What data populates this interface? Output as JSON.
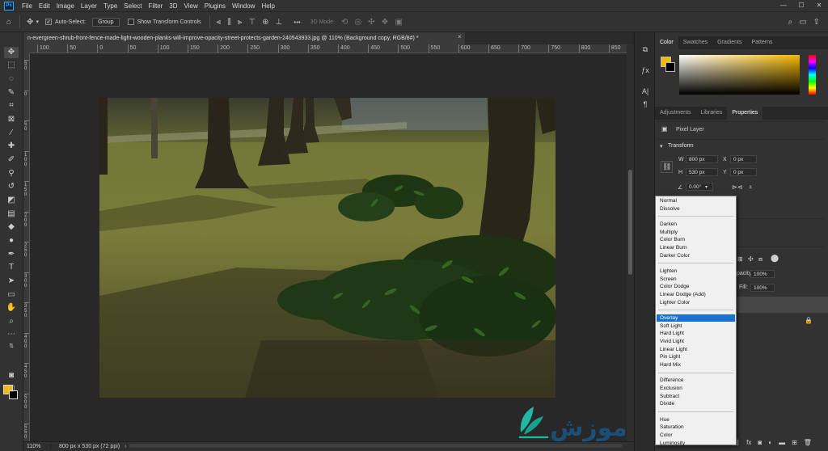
{
  "app": {
    "logo": "Ps"
  },
  "menu": [
    "File",
    "Edit",
    "Image",
    "Layer",
    "Type",
    "Select",
    "Filter",
    "3D",
    "View",
    "Plugins",
    "Window",
    "Help"
  ],
  "window_controls": {
    "minimize": "—",
    "maximize": "☐",
    "close": "✕"
  },
  "options_bar": {
    "auto_select_label": "Auto-Select:",
    "auto_select_checked": true,
    "group_value": "Group",
    "transform_label": "Show Transform Controls",
    "transform_checked": false,
    "more": "•••",
    "mode_3d_label": "3D Mode:"
  },
  "document": {
    "tab_title": "n-evergreen-shrub-front-fence-made-light-wooden-planks-will-improve-opacity-street-protects-garden-240543933.jpg @ 110% (Background copy, RGB/8#) *",
    "close": "×",
    "zoom": "110%",
    "info": "800 px x 530 px (72 ppi)",
    "info_arrow": "›"
  },
  "ruler": {
    "h_labels": [
      "100",
      "50",
      "0",
      "50",
      "100",
      "150",
      "200",
      "250",
      "300",
      "350",
      "400",
      "450",
      "500",
      "550",
      "600",
      "650",
      "700",
      "750",
      "800",
      "850",
      "900"
    ],
    "v_labels": [
      "50",
      "0",
      "50",
      "100",
      "150",
      "200",
      "250",
      "300",
      "350",
      "400",
      "450",
      "500",
      "550"
    ]
  },
  "colors": {
    "foreground": "#f5b800",
    "background": "#000000",
    "accent": "#1870d0"
  },
  "color_panel": {
    "tabs": [
      "Color",
      "Swatches",
      "Gradients",
      "Patterns"
    ],
    "active": "Color"
  },
  "properties_panel": {
    "tabs": [
      "Adjustments",
      "Libraries",
      "Properties"
    ],
    "active": "Properties",
    "layer_type": "Pixel Layer",
    "section": "Transform",
    "w_label": "W",
    "w_value": "800 px",
    "h_label": "H",
    "h_value": "530 px",
    "x_label": "X",
    "x_value": "0 px",
    "y_label": "Y",
    "y_value": "0 px",
    "angle_value": "0.00°"
  },
  "layers_panel": {
    "opacity_label": "pacity:",
    "opacity_value": "100%",
    "fill_label": "Fill:",
    "fill_value": "100%"
  },
  "blend_dropdown": {
    "groups": [
      [
        "Normal",
        "Dissolve"
      ],
      [
        "Darken",
        "Multiply",
        "Color Burn",
        "Linear Burn",
        "Darker Color"
      ],
      [
        "Lighten",
        "Screen",
        "Color Dodge",
        "Linear Dodge (Add)",
        "Lighter Color"
      ],
      [
        "Overlay",
        "Soft Light",
        "Hard Light",
        "Vivid Light",
        "Linear Light",
        "Pin Light",
        "Hard Mix"
      ],
      [
        "Difference",
        "Exclusion",
        "Subtract",
        "Divide"
      ],
      [
        "Hue",
        "Saturation",
        "Color",
        "Luminosity"
      ]
    ],
    "selected": "Overlay"
  },
  "watermark": {
    "text": "آموزش"
  }
}
